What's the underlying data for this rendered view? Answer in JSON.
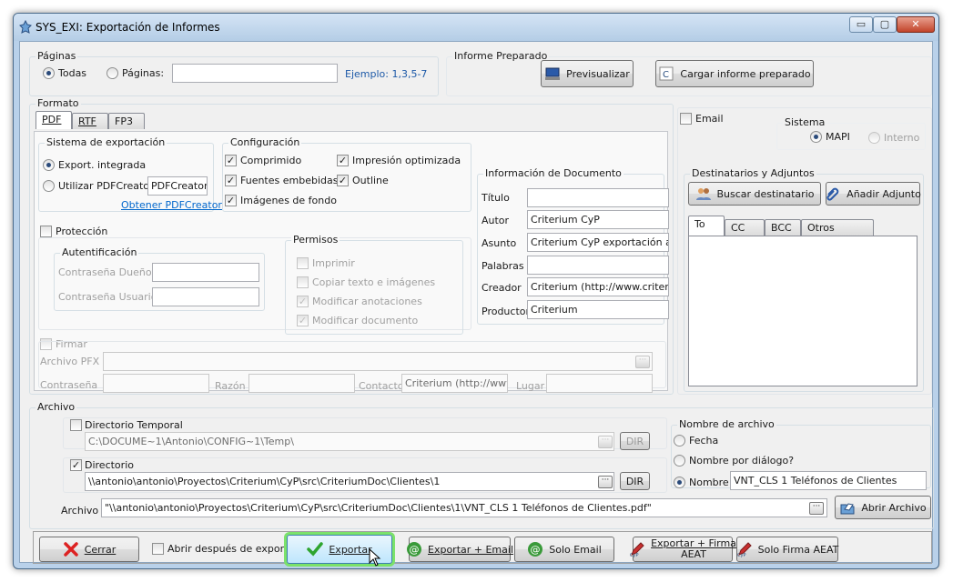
{
  "window": {
    "title": "SYS_EXI: Exportación de Informes",
    "min": "▭",
    "max": "▢",
    "close": "✕"
  },
  "paginas": {
    "title": "Páginas",
    "todas": "Todas",
    "paginas": "Páginas:",
    "value": "",
    "example": "Ejemplo: 1,3,5-7"
  },
  "informe": {
    "title": "Informe Preparado",
    "previsualizar": "Previsualizar",
    "cargar": "Cargar informe preparado"
  },
  "formato": {
    "title": "Formato",
    "tabs": [
      "PDF",
      "RTF",
      "FP3"
    ],
    "sistema": {
      "title": "Sistema de exportación",
      "integrada": "Export. integrada",
      "utilizar": "Utilizar PDFCreator",
      "pdfcreator_value": "PDFCreator",
      "obtener": "Obtener PDFCreator"
    },
    "config": {
      "title": "Configuración",
      "comprimido": "Comprimido",
      "fuentes": "Fuentes embebidas",
      "imagenes": "Imágenes de fondo",
      "impresion": "Impresión optimizada",
      "outline": "Outline"
    },
    "proteccion": {
      "label": "Protección",
      "auth_title": "Autentificación",
      "dueno": "Contraseña Dueño",
      "usuario": "Contraseña Usuario",
      "permisos_title": "Permisos",
      "imprimir": "Imprimir",
      "copiar": "Copiar texto e imágenes",
      "mod_anot": "Modificar anotaciones",
      "mod_doc": "Modificar documento"
    },
    "info": {
      "title": "Información de Documento",
      "titulo": "Título",
      "titulo_val": "",
      "autor": "Autor",
      "autor_val": "Criterium CyP",
      "asunto": "Asunto",
      "asunto_val": "Criterium CyP exportación a PD",
      "palabras": "Palabras",
      "palabras_val": "",
      "creador": "Creador",
      "creador_val": "Criterium (http://www.criterium.",
      "productor": "Productor",
      "productor_val": "Criterium"
    },
    "firmar": {
      "label": "Firmar",
      "pfx": "Archivo PFX",
      "contrasena": "Contraseña",
      "razon": "Razón",
      "contacto": "Contacto",
      "contacto_val": "Criterium (http://www.c",
      "lugar": "Lugar"
    }
  },
  "email": {
    "label": "Email",
    "sistema_title": "Sistema",
    "mapi": "MAPI",
    "interno": "Interno",
    "dest_title": "Destinatarios y Adjuntos",
    "buscar": "Buscar destinatario",
    "anadir": "Añadir Adjunto",
    "tabs": [
      "To",
      "CC",
      "BCC",
      "Otros Adjuntos"
    ]
  },
  "archivo": {
    "title": "Archivo",
    "dir_temp": "Directorio Temporal",
    "dir_temp_val": "C:\\DOCUME~1\\Antonio\\CONFIG~1\\Temp\\",
    "directorio": "Directorio",
    "directorio_val": "\\\\antonio\\antonio\\Proyectos\\Criterium\\CyP\\src\\CriteriumDoc\\Clientes\\1",
    "dir_btn": "DIR",
    "archivo_label": "Archivo",
    "archivo_val": "\"\\\\antonio\\antonio\\Proyectos\\Criterium\\CyP\\src\\CriteriumDoc\\Clientes\\1\\VNT_CLS 1 Teléfonos de Clientes.pdf\"",
    "abrir_archivo": "Abrir Archivo",
    "nombre_title": "Nombre de archivo",
    "fecha": "Fecha",
    "por_dialogo": "Nombre por diálogo?",
    "nombre": "Nombre",
    "nombre_val": "VNT_CLS 1 Teléfonos de Clientes",
    "dots": "···"
  },
  "footer": {
    "cerrar": "Cerrar",
    "abrir_despues": "Abrir después de exportar",
    "exportar": "Exportar",
    "exportar_email": "Exportar + Email",
    "solo_email": "Solo Email",
    "exportar_firma_1": "Exportar + Firma",
    "exportar_firma_2": "AEAT",
    "solo_firma": "Solo Firma AEAT"
  },
  "colors": {
    "accent": "#0066cc",
    "title_bg": "#b9d1ea",
    "exportar_glow": "#7be26a"
  }
}
